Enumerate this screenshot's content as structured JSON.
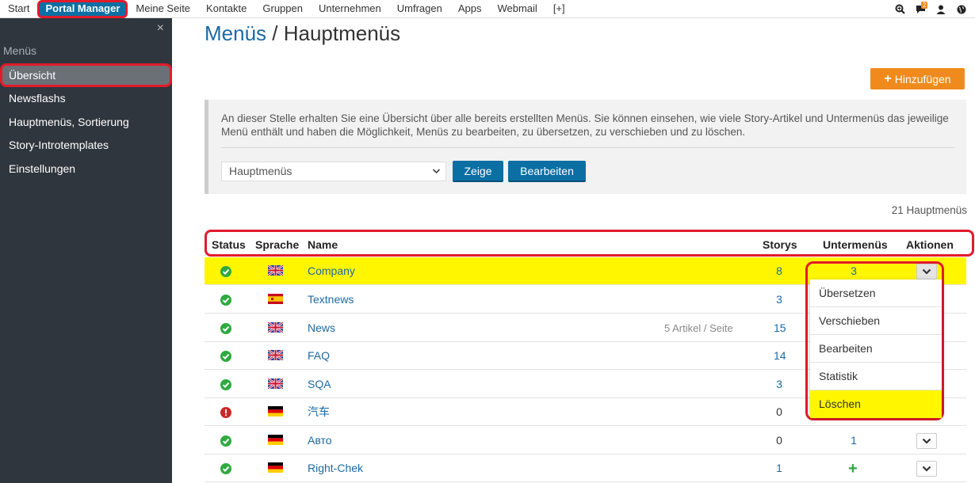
{
  "topnav": {
    "items": [
      "Start",
      "Portal Manager",
      "Meine Seite",
      "Kontakte",
      "Gruppen",
      "Unternehmen",
      "Umfragen",
      "Apps",
      "Webmail",
      "[+]"
    ],
    "active_index": 1,
    "icons": [
      "search-icon",
      "chat-icon",
      "user-icon",
      "globe-icon"
    ],
    "chat_badge": "2"
  },
  "sidebar": {
    "close_glyph": "×",
    "heading": "Menüs",
    "items": [
      "Übersicht",
      "Newsflashs",
      "Hauptmenüs, Sortierung",
      "Story-Introtemplates",
      "Einstellungen"
    ],
    "active_index": 0
  },
  "page": {
    "title_part1": "Menüs",
    "title_sep": " / ",
    "title_part2": "Hauptmenüs",
    "add_button": "Hinzufügen",
    "info_text": "An dieser Stelle erhalten Sie eine Übersicht über alle bereits erstellten Menüs. Sie können einsehen, wie viele Story-Artikel und Untermenüs das jeweilige Menü enthält und haben die Möglichkeit, Menüs zu bearbeiten, zu übersetzen, zu verschieben und zu löschen.",
    "select_value": "Hauptmenüs",
    "show_button": "Zeige",
    "edit_button": "Bearbeiten",
    "count_text": "21 Hauptmenüs"
  },
  "table": {
    "headers": {
      "status": "Status",
      "language": "Sprache",
      "name": "Name",
      "storys": "Storys",
      "submenus": "Untermenüs",
      "actions": "Aktionen"
    },
    "rows": [
      {
        "status": "ok",
        "flag": "uk",
        "name": "Company",
        "note": "",
        "storys": "8",
        "submenus": "3",
        "highlight": true
      },
      {
        "status": "ok",
        "flag": "es",
        "name": "Textnews",
        "note": "",
        "storys": "3",
        "submenus": "",
        "highlight": false
      },
      {
        "status": "ok",
        "flag": "uk",
        "name": "News",
        "note": "5 Artikel / Seite",
        "storys": "15",
        "submenus": "",
        "highlight": false
      },
      {
        "status": "ok",
        "flag": "uk",
        "name": "FAQ",
        "note": "",
        "storys": "14",
        "submenus": "",
        "highlight": false
      },
      {
        "status": "ok",
        "flag": "uk",
        "name": "SQA",
        "note": "",
        "storys": "3",
        "submenus": "",
        "highlight": false
      },
      {
        "status": "error",
        "flag": "de",
        "name": "汽车",
        "note": "",
        "storys": "0",
        "submenus": "",
        "highlight": false
      },
      {
        "status": "ok",
        "flag": "de",
        "name": "Авто",
        "note": "",
        "storys": "0",
        "submenus": "1",
        "highlight": false
      },
      {
        "status": "ok",
        "flag": "de",
        "name": "Right-Chek",
        "note": "",
        "storys": "1",
        "submenus": "+",
        "highlight": false
      }
    ]
  },
  "dropdown": {
    "items": [
      "Übersetzen",
      "Verschieben",
      "Bearbeiten",
      "Statistik",
      "Löschen"
    ],
    "highlight_index": 4
  },
  "colors": {
    "accent_blue": "#0b6fa4",
    "link_blue": "#1c6aa3",
    "orange": "#f18a1c",
    "highlight_yellow": "#fff600",
    "annotation_red": "#e21b2b",
    "sidebar_bg": "#30363d",
    "status_green": "#2eaa3f",
    "status_red": "#c72a2a"
  }
}
